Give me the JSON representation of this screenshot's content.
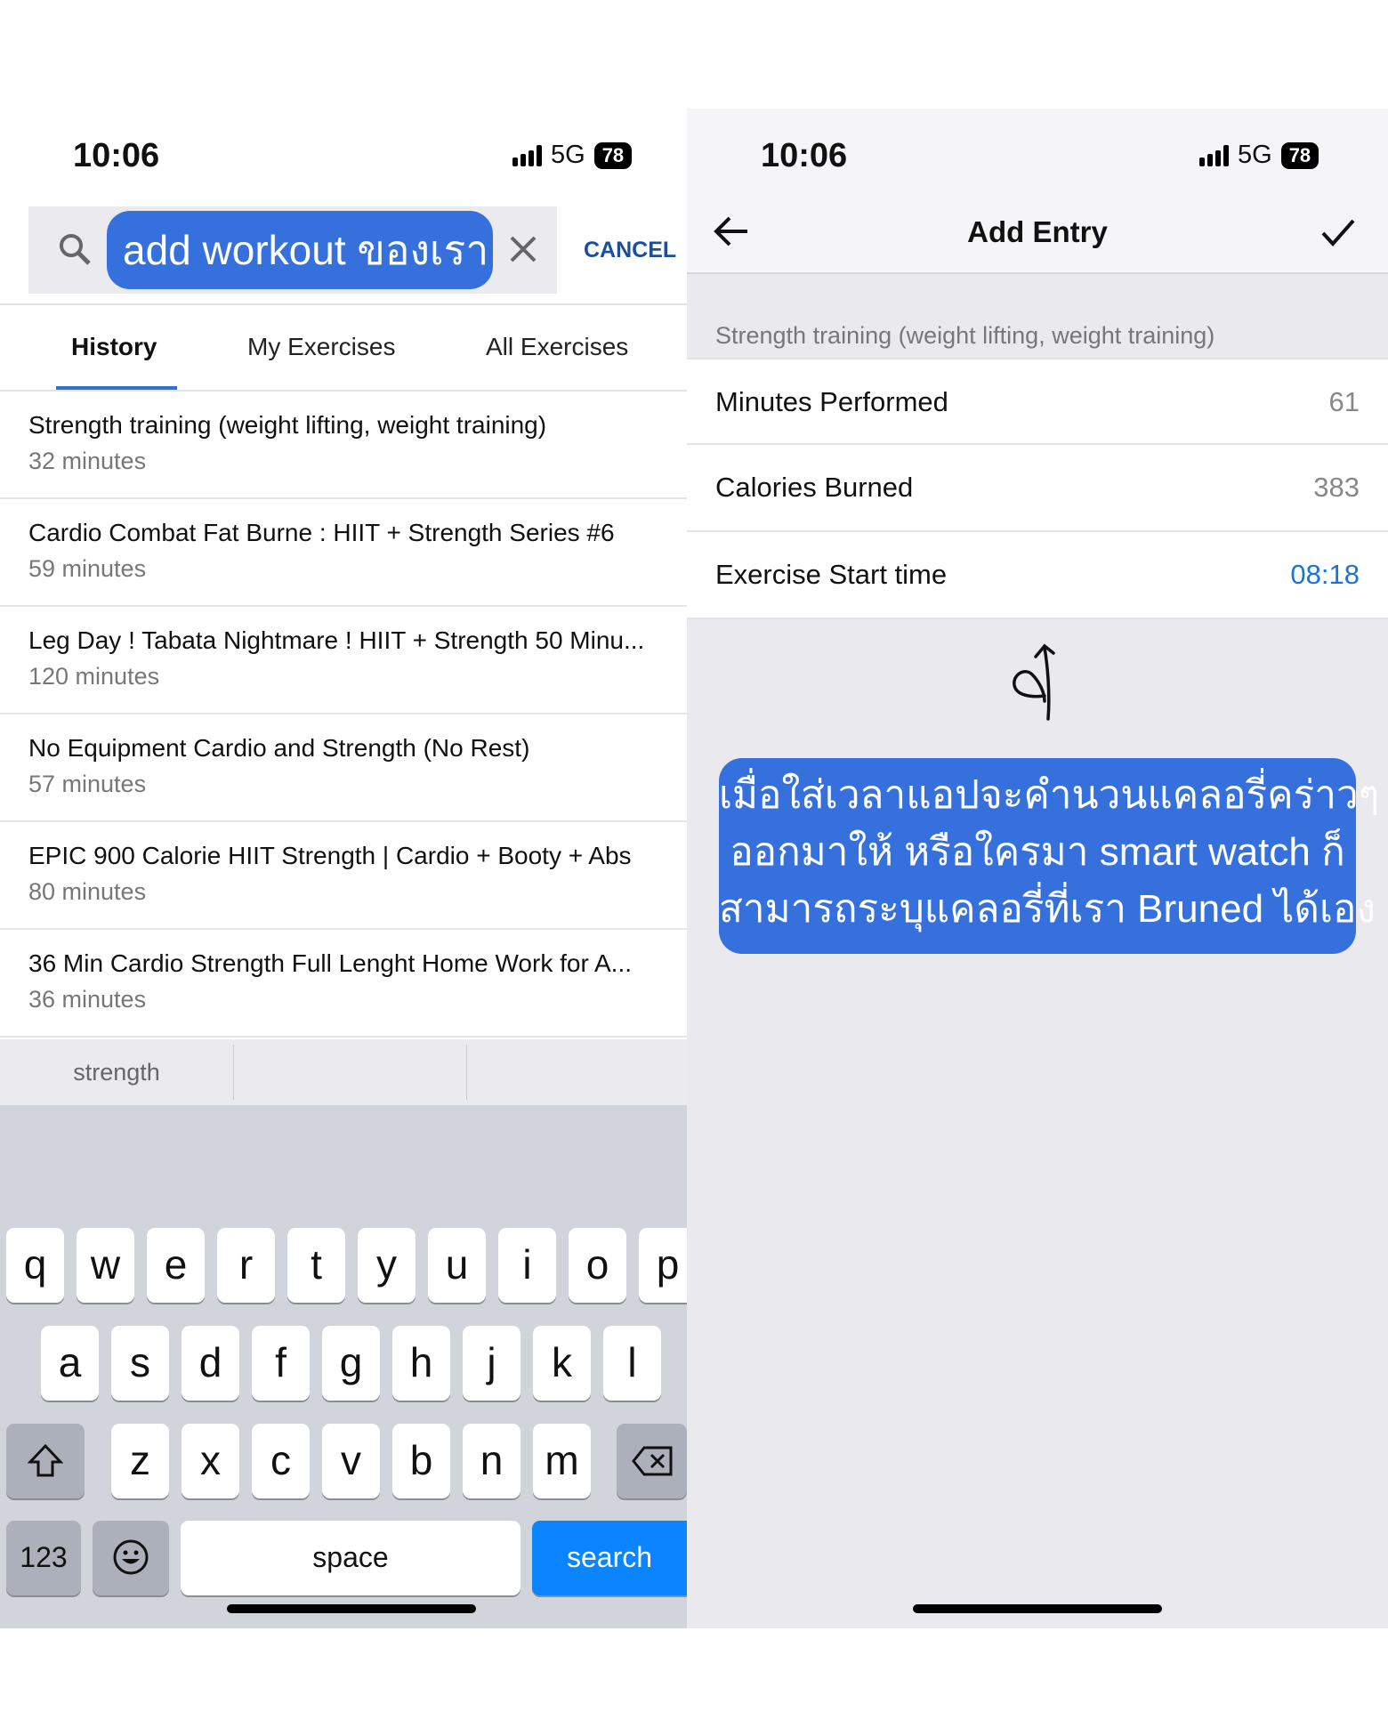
{
  "left": {
    "time": "10:06",
    "network": "5G",
    "battery": "78",
    "search": {
      "value": "add workout ของเรา",
      "cancel": "CANCEL"
    },
    "tabs": [
      {
        "label": "History",
        "active": true
      },
      {
        "label": "My Exercises"
      },
      {
        "label": "All Exercises"
      }
    ],
    "history": [
      {
        "title": "Strength training (weight lifting, weight training)",
        "duration": "32 minutes"
      },
      {
        "title": "Cardio Combat Fat Burne : HIIT + Strength Series #6",
        "duration": "59 minutes"
      },
      {
        "title": "Leg Day ! Tabata Nightmare ! HIIT + Strength 50 Minu...",
        "duration": "120 minutes"
      },
      {
        "title": "No Equipment Cardio and Strength (No Rest)",
        "duration": "57 minutes"
      },
      {
        "title": "EPIC 900 Calorie HIIT Strength | Cardio + Booty + Abs",
        "duration": "80 minutes"
      },
      {
        "title": "36 Min Cardio Strength Full Lenght Home Work for A...",
        "duration": "36 minutes"
      }
    ],
    "suggestion": "strength",
    "keyboard": {
      "row1": [
        "q",
        "w",
        "e",
        "r",
        "t",
        "y",
        "u",
        "i",
        "o",
        "p"
      ],
      "row2": [
        "a",
        "s",
        "d",
        "f",
        "g",
        "h",
        "j",
        "k",
        "l"
      ],
      "row3": [
        "z",
        "x",
        "c",
        "v",
        "b",
        "n",
        "m"
      ],
      "numbers": "123",
      "space": "space",
      "search": "search"
    }
  },
  "right": {
    "time": "10:06",
    "network": "5G",
    "battery": "78",
    "title": "Add Entry",
    "section": "Strength training (weight lifting, weight training)",
    "fields": [
      {
        "label": "Minutes Performed",
        "value": "61"
      },
      {
        "label": "Calories Burned",
        "value": "383"
      },
      {
        "label": "Exercise Start time",
        "value": "08:18"
      }
    ],
    "annotation": [
      "เมื่อใส่เวลาแอปจะคำนวนแคลอรี่คร่าวๆ",
      "ออกมาให้ หรือใครมา smart watch ก็",
      "สามารถระบุแคลอรี่ที่เรา Bruned ได้เอง"
    ]
  },
  "colors": {
    "accent": "#3570dc",
    "link": "#1a73d9",
    "keyboard_search": "#0a84ff"
  }
}
